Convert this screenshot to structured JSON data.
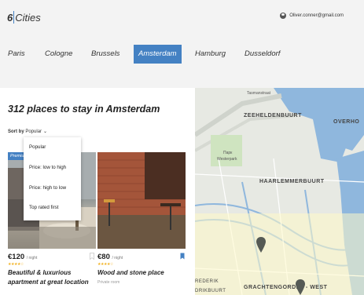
{
  "header": {
    "logo_number": "6",
    "logo_text": "Cities",
    "user_email": "Oliver.conner@gmail.com"
  },
  "tabs": [
    {
      "label": "Paris"
    },
    {
      "label": "Cologne"
    },
    {
      "label": "Brussels"
    },
    {
      "label": "Amsterdam",
      "active": true
    },
    {
      "label": "Hamburg"
    },
    {
      "label": "Dusseldorf"
    }
  ],
  "main": {
    "title": "312 places to stay in Amsterdam",
    "sort_label": "Sort by",
    "sort_value": "Popular",
    "sort_options": [
      "Popular",
      "Price: low to high",
      "Price: high to low",
      "Top rated first"
    ]
  },
  "cards": [
    {
      "badge": "Premium",
      "price": "€120",
      "per_night": "/ night",
      "stars": "★★★★☆",
      "title_line1": "Beautiful & luxurious",
      "title_line2": "apartment at great location"
    },
    {
      "price": "€80",
      "per_night": "/ night",
      "stars": "★★★★☆",
      "title": "Wood and stone place",
      "type": "Private room"
    }
  ],
  "map": {
    "labels": [
      "ZEEHELDENBUURT",
      "OVERHO",
      "HAARLEMMERBUURT",
      "GRACHTENGORDEL - WEST",
      "REDERIK",
      "DRIKBUURT"
    ],
    "small_labels": [
      "Парк",
      "Westerpark",
      "Tasmanstraat"
    ]
  },
  "colors": {
    "accent": "#4481c3",
    "star": "#f2b01e",
    "water": "#8fb7dd"
  }
}
